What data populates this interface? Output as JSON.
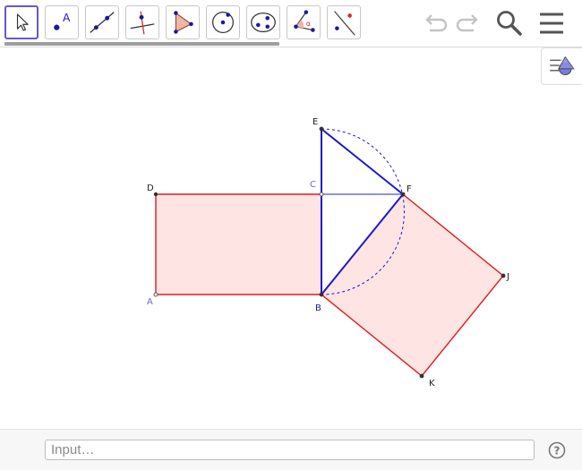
{
  "toolbar": {
    "tools": [
      {
        "name": "move-tool",
        "active": true
      },
      {
        "name": "point-tool",
        "label": "A"
      },
      {
        "name": "line-tool"
      },
      {
        "name": "perpendicular-line-tool"
      },
      {
        "name": "polygon-tool"
      },
      {
        "name": "circle-center-point-tool"
      },
      {
        "name": "conic-tool"
      },
      {
        "name": "angle-tool",
        "label": "α"
      },
      {
        "name": "reflect-tool"
      }
    ],
    "right": [
      "undo-icon",
      "redo-icon",
      "search-icon",
      "menu-icon"
    ]
  },
  "canvas": {
    "points": {
      "A": "A",
      "B": "B",
      "C": "C",
      "D": "D",
      "E": "E",
      "F": "F",
      "J": "J",
      "K": "K"
    },
    "colors": {
      "fill": "#ffe4e4",
      "polygon_stroke": "#e01b1b",
      "triangle_stroke": "#1a1acc",
      "muted_label": "#6a6ac8",
      "point": "#333333"
    }
  },
  "input": {
    "placeholder": "Input…"
  },
  "help": {
    "label": "?"
  }
}
